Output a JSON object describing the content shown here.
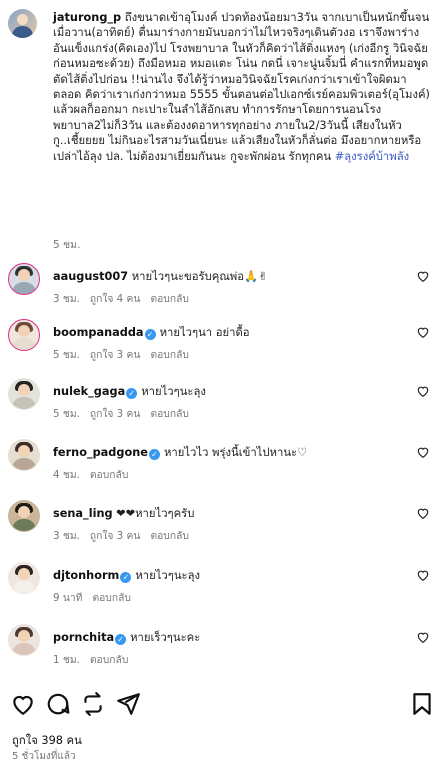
{
  "caption": {
    "username": "jaturong_p",
    "text": "ถึงขนาดเข้าอุโมงค์ ปวดท้องน้อยมา3วัน จากเบาเป็นหนักขึ้นจนเมื่อวาน(อาทิตย์) ตื่นมาร่างกายมันบอกว่าไม่ไหวจริงๆเดินตัวงอ เราจึงพาร่างอันแข็งแกร่ง(คิดเอง)ไป โรงพยาบาล ในหัวก็คิดว่าไส้ติ่งแหงๆ (เก่งอีกรู วินิจฉัยก่อนหมอซะด้วย) ถึงมือหมอ หมอแตะ โน่น กดนี่ เจาะนู่นจิ้มนี่ คำแรกที่หมอพูด ตัดไส้ติ่งไปก่อน !!น่านไง จึงได้รู้ว่าหมอวินิจฉัยโรคเก่งกว่าเราเข้าใจผิดมาตลอด คิดว่าเราเก่งกว่าหมอ 5555 ขั้นตอนต่อไปเอกซ์เรย์คอมพิวเตอร์(อุโมงค์) แล้วผลก็ออกมา กะเปาะในลำไส้อักเสบ ทำการรักษาโดยการนอนโรงพยาบาล2ไม่ก็3วัน และต้องงดอาหารทุกอย่าง ภายใน2/3วันนี้ เสียงในหัวกู..เชี้ยยยย ไม่กินอะไรสามวันเนี่ยนะ แล้วเสียงในหัวก็ลั่นต่อ มึงอยากหายหรือเปล่าไอ้ลุง ปล. ไม่ต้องมาเยี่ยมกันนะ กูจะพักผ่อน รักทุกคน",
    "hashtag": "#ลุงรงค์บ้าพลัง",
    "time": "5 ชม."
  },
  "comments": [
    {
      "username": "aaugust007",
      "verified": false,
      "text": "หายไวๆนะขอรับคุณพ่อ🙏✌",
      "time": "3 ชม.",
      "likes": "ถูกใจ 4 คน",
      "reply": "ตอบกลับ"
    },
    {
      "username": "boompanadda",
      "verified": true,
      "text": "หายไวๆนา อย่าดื้อ",
      "time": "5 ชม.",
      "likes": "ถูกใจ 3 คน",
      "reply": "ตอบกลับ"
    },
    {
      "username": "nulek_gaga",
      "verified": true,
      "text": "หายไวๆนะลุง",
      "time": "5 ชม.",
      "likes": "ถูกใจ 3 คน",
      "reply": "ตอบกลับ"
    },
    {
      "username": "ferno_padgone",
      "verified": true,
      "text": "หายไวไว พรุ่งนี้เข้าไปหานะ♡",
      "time": "4 ชม.",
      "likes": "",
      "reply": "ตอบกลับ"
    },
    {
      "username": "sena_ling",
      "verified": false,
      "text": "❤❤หายไวๆครับ",
      "time": "3 ชม.",
      "likes": "ถูกใจ 3 คน",
      "reply": "ตอบกลับ"
    },
    {
      "username": "djtonhorm",
      "verified": true,
      "text": "หายไวๆนะลุง",
      "time": "9 นาที",
      "likes": "",
      "reply": "ตอบกลับ"
    },
    {
      "username": "pornchita",
      "verified": true,
      "text": "หายเร็วๆนะคะ",
      "time": "1 ชม.",
      "likes": "",
      "reply": "ตอบกลับ"
    }
  ],
  "post": {
    "likes": "ถูกใจ 398 คน",
    "time": "5 ชั่วโมงที่แล้ว"
  },
  "icons": {
    "like": "heart-icon",
    "comment": "comment-icon",
    "share": "repost-icon",
    "send": "send-icon",
    "save": "bookmark-icon"
  }
}
